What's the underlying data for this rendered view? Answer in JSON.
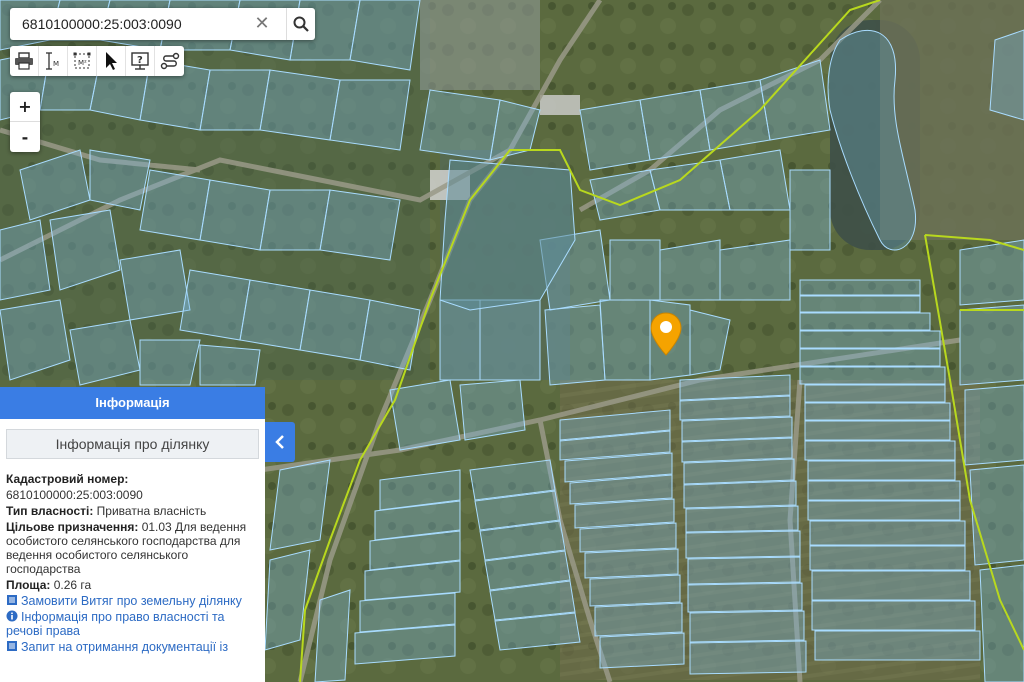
{
  "search": {
    "value": "6810100000:25:003:0090"
  },
  "toolbar": {
    "tools": [
      "printer-icon",
      "measure-line-icon",
      "measure-area-icon",
      "pointer-icon",
      "help-icon",
      "route-icon"
    ],
    "zoom_in": "+",
    "zoom_out": "-"
  },
  "map": {
    "layer": "satellite",
    "parcel_outline_color": "#8fd0ff",
    "boundary_color": "#b8d81e",
    "marker_color": "#f5a300"
  },
  "info_panel": {
    "header": "Інформація",
    "subtitle": "Інформація про ділянку",
    "cadastral_label": "Кадастровий номер:",
    "cadastral_value": "6810100000:25:003:0090",
    "ownership_label": "Тип власності:",
    "ownership_value": "Приватна власність",
    "purpose_label": "Цільове призначення:",
    "purpose_value": "01.03 Для ведення особистого селянського господарства для ведення особистого селянського господарства",
    "area_label": "Площа:",
    "area_value": "0.26 га",
    "links": [
      {
        "icon": "document-icon",
        "label": "Замовити Витяг про земельну ділянку"
      },
      {
        "icon": "info-icon",
        "label": "Інформація про право власності та речові права"
      },
      {
        "icon": "document-icon",
        "label": "Запит на отримання документації із"
      }
    ]
  }
}
